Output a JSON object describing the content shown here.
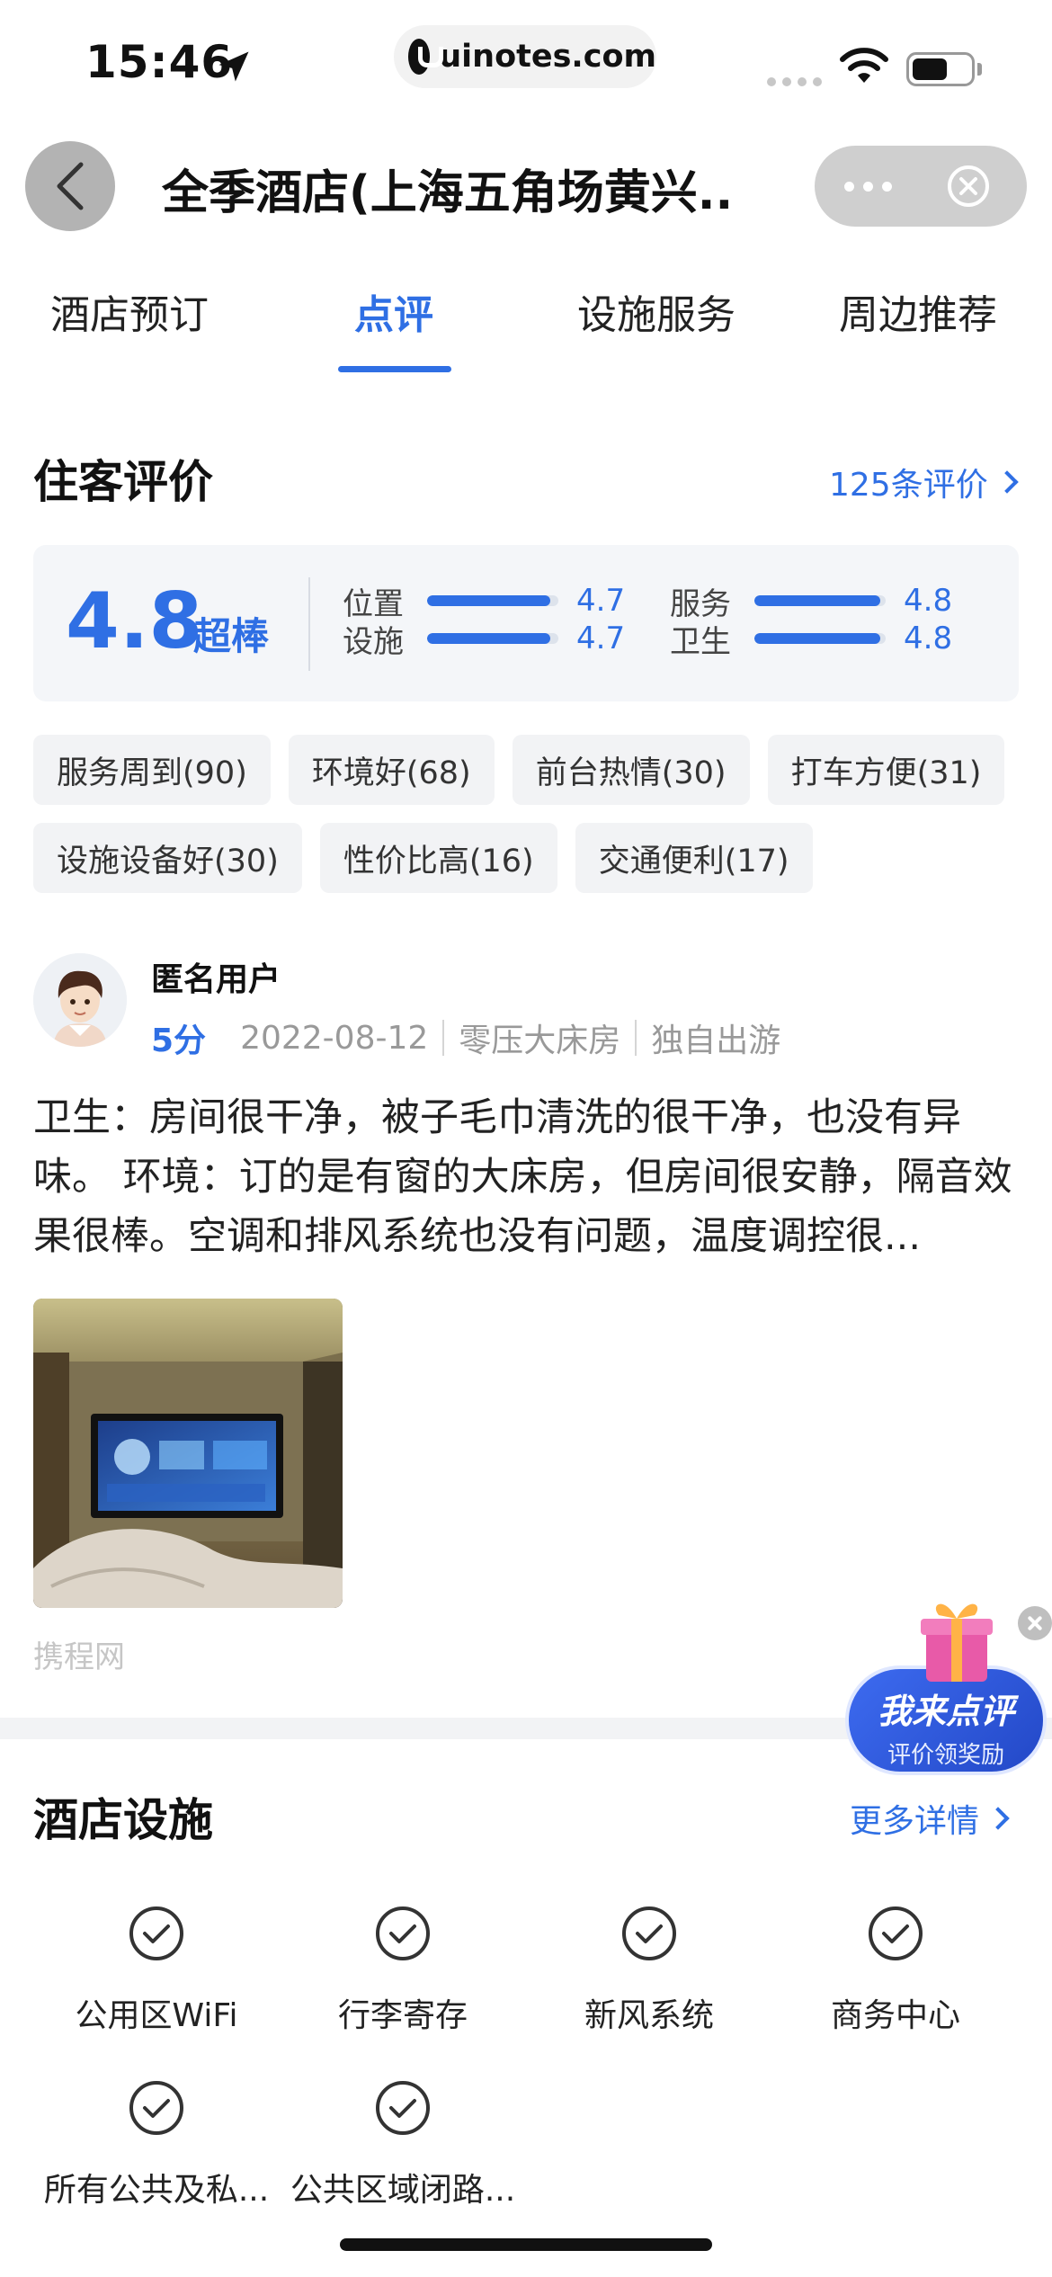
{
  "status_bar": {
    "time": "15:46",
    "url": "uinotes.com"
  },
  "header": {
    "title": "全季酒店(上海五角场黄兴..."
  },
  "tabs": [
    {
      "label": "酒店预订",
      "active": false
    },
    {
      "label": "点评",
      "active": true
    },
    {
      "label": "设施服务",
      "active": false
    },
    {
      "label": "周边推荐",
      "active": false
    }
  ],
  "reviews": {
    "section_title": "住客评价",
    "count_link": "125条评价",
    "overall_score": "4.8",
    "overall_label": "超棒",
    "sub_ratings": [
      {
        "name": "位置",
        "value": "4.7",
        "fraction": 0.94
      },
      {
        "name": "服务",
        "value": "4.8",
        "fraction": 0.96
      },
      {
        "name": "设施",
        "value": "4.7",
        "fraction": 0.94
      },
      {
        "name": "卫生",
        "value": "4.8",
        "fraction": 0.96
      }
    ],
    "tags": [
      "服务周到(90)",
      "环境好(68)",
      "前台热情(30)",
      "打车方便(31)",
      "设施设备好(30)",
      "性价比高(16)",
      "交通便利(17)"
    ],
    "review": {
      "user": "匿名用户",
      "score": "5分",
      "date": "2022-08-12",
      "room": "零压大床房",
      "trip": "独自出游",
      "text": "卫生：房间很干净，被子毛巾清洗的很干净，也没有异味。 环境：订的是有窗的大床房，但房间很安静，隔音效果很棒。空调和排风系统也没有问题，温度调控很...",
      "photo_source": "携程网"
    }
  },
  "facilities": {
    "section_title": "酒店设施",
    "more_link": "更多详情",
    "items": [
      "公用区WiFi",
      "行李寄存",
      "新风系统",
      "商务中心",
      "所有公共及私...",
      "公共区域闭路..."
    ]
  },
  "floating_button": {
    "title": "我来点评",
    "subtitle": "评价领奖励"
  },
  "colors": {
    "accent": "#2f6fe4",
    "tag_bg": "#f2f3f5",
    "card_bg": "#f4f6f9"
  }
}
